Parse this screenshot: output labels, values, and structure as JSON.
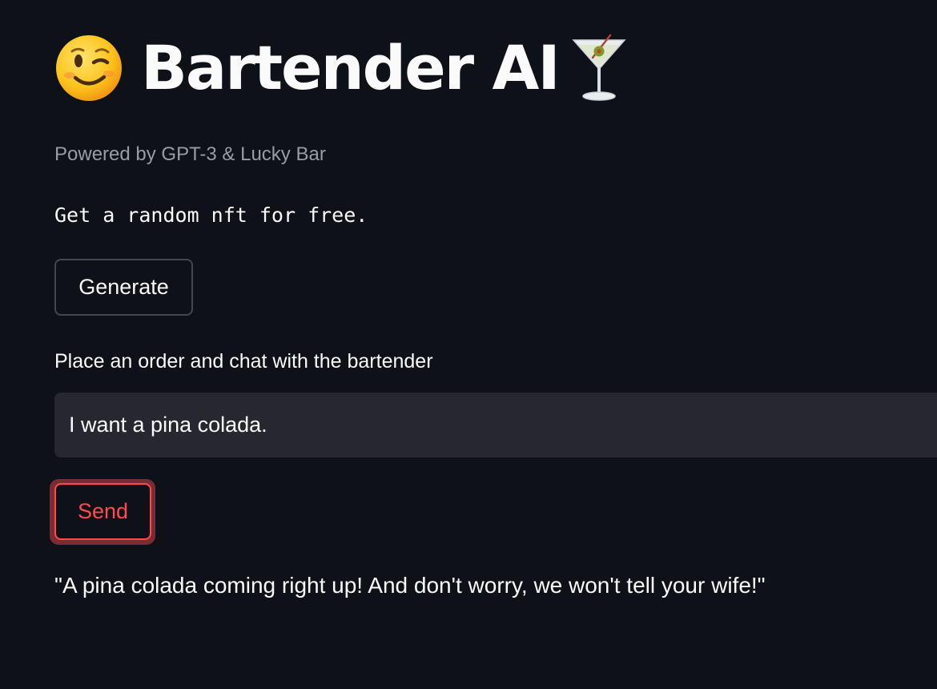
{
  "header": {
    "title": "Bartender AI",
    "leading_icon": "winking-face-emoji",
    "trailing_icon": "cocktail-glass-emoji"
  },
  "caption": "Powered by GPT-3 & Lucky Bar",
  "nft": {
    "text": "Get a random nft for free.",
    "button_label": "Generate"
  },
  "order": {
    "label": "Place an order and chat with the bartender",
    "input_value": "I want a pina colada.",
    "send_label": "Send"
  },
  "response": "\"A pina colada coming right up! And don't worry, we won't tell your wife!\"",
  "colors": {
    "background": "#0e1117",
    "input_background": "#262730",
    "accent": "#ff4b4b",
    "caption": "#9a9ca3"
  }
}
